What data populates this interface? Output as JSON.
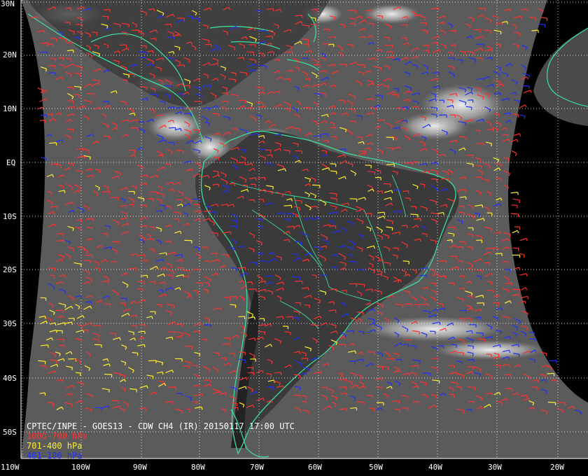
{
  "map": {
    "latitude_labels": [
      "30N",
      "20N",
      "10N",
      "EQ",
      "10S",
      "20S",
      "30S",
      "40S",
      "50S"
    ],
    "longitude_labels": [
      "110W",
      "100W",
      "90W",
      "80W",
      "70W",
      "60W",
      "50W",
      "40W",
      "30W",
      "20W"
    ],
    "grid_color": "#ffffff",
    "coastline_color": "#3ddc9a",
    "background_color": "#000000"
  },
  "legend": {
    "title": "CPTEC/INPE - GOES13 - CDW CH4 (IR) 20150117 17:00 UTC",
    "entries": [
      {
        "label": "1000-700 hPa",
        "color": "#ff3030"
      },
      {
        "label": "701-400 hPa",
        "color": "#ffee30"
      },
      {
        "label": "401-100 hPa",
        "color": "#2030ff"
      }
    ]
  }
}
